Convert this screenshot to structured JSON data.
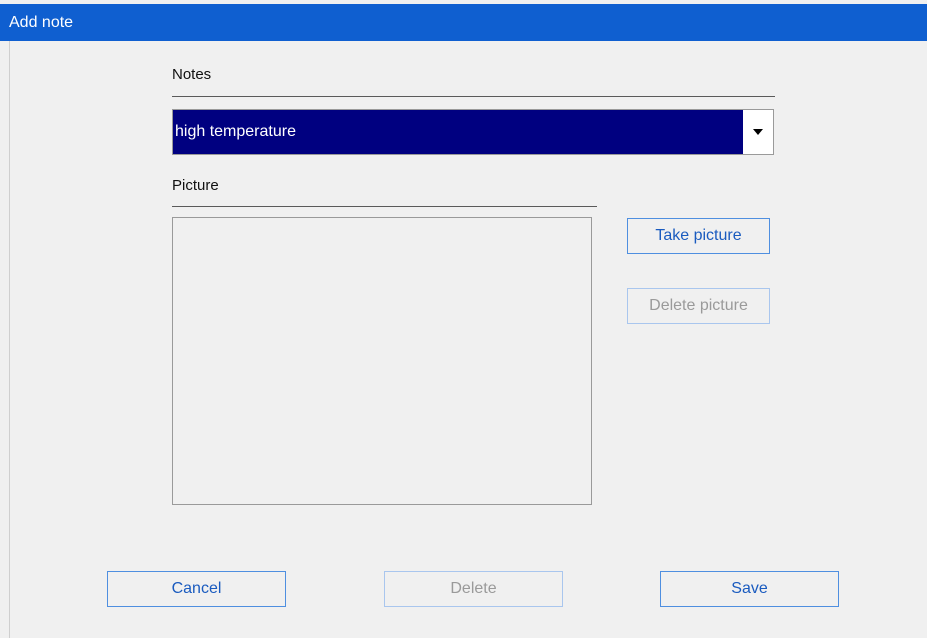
{
  "window": {
    "title": "Add note"
  },
  "notes": {
    "label": "Notes",
    "selected_value": "high temperature"
  },
  "picture": {
    "label": "Picture",
    "take_picture_label": "Take picture",
    "delete_picture_label": "Delete picture",
    "delete_picture_enabled": false
  },
  "footer": {
    "cancel_label": "Cancel",
    "delete_label": "Delete",
    "delete_enabled": false,
    "save_label": "Save"
  },
  "colors": {
    "titlebar": "#0f5fd0",
    "selection": "#000080",
    "button_border": "#4f8fe0",
    "button_text": "#1a5bbf"
  },
  "icons": {
    "dropdown": "chevron-down-icon"
  }
}
